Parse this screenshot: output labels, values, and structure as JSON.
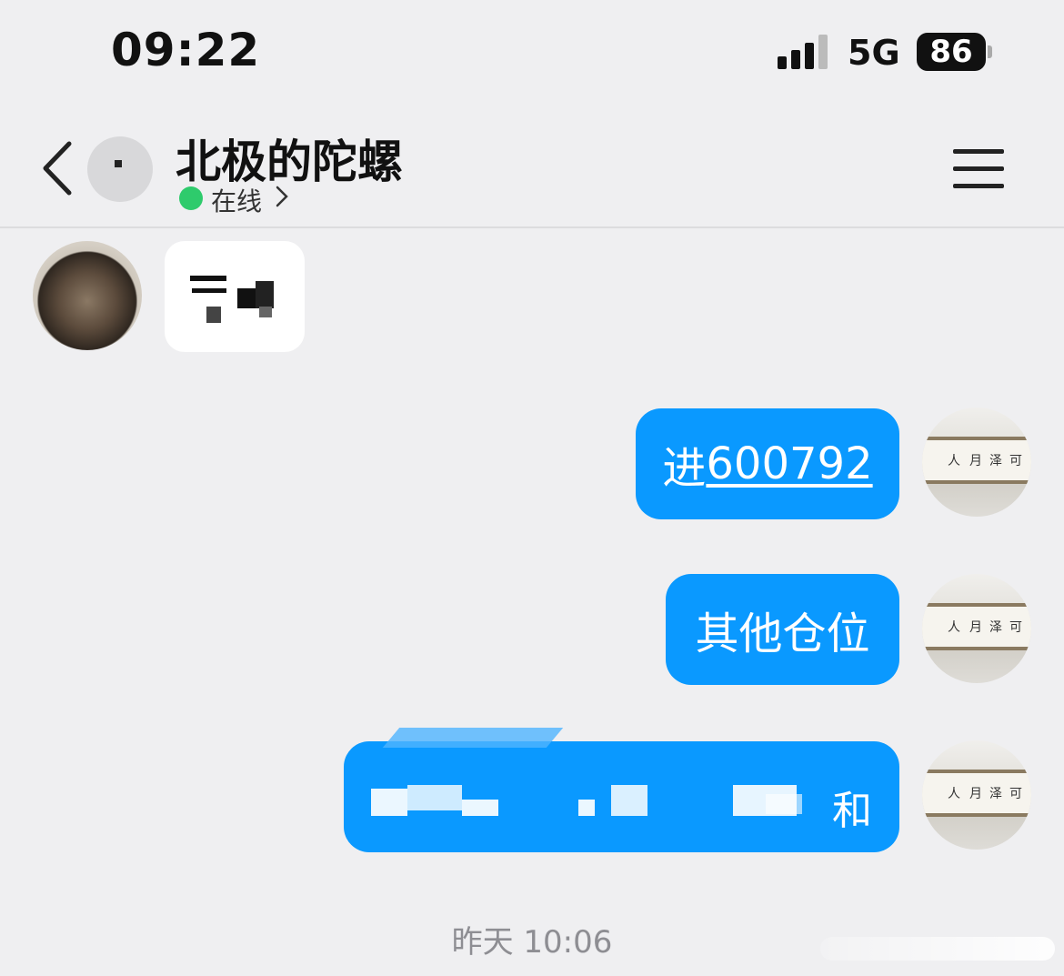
{
  "status_bar": {
    "time": "09:22",
    "network": "5G",
    "battery": "86"
  },
  "header": {
    "title": "北极的陀螺",
    "status": "在线"
  },
  "messages": {
    "out1": {
      "prefix": "进",
      "code": "600792"
    },
    "out2": {
      "text": "其他仓位"
    },
    "out3": {
      "tail": "和"
    }
  },
  "timestamp": "昨天 10:06",
  "colors": {
    "bubble_out": "#0a99ff",
    "online": "#2ecb6c",
    "background": "#efeff1"
  },
  "icons": [
    "signal-icon",
    "battery-icon",
    "back-icon",
    "chevron-right-icon",
    "menu-icon"
  ]
}
